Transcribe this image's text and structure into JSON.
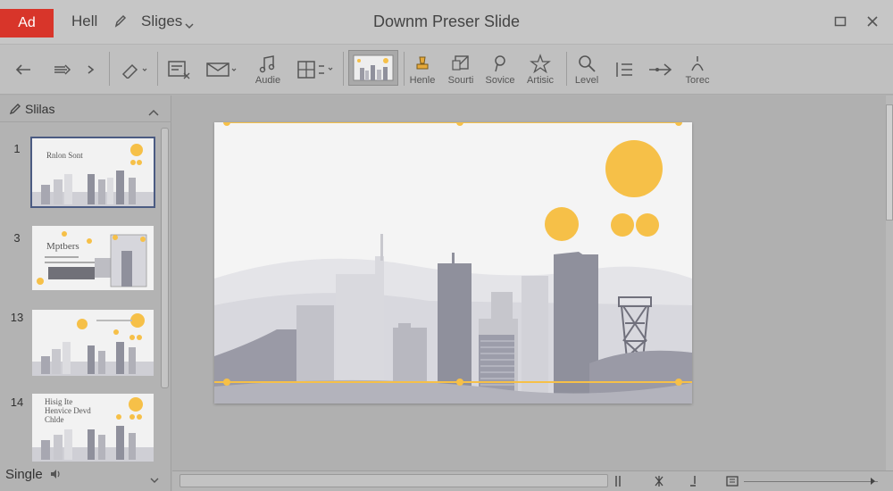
{
  "titlebar": {
    "app_button": "Ad",
    "menu": [
      "Hell",
      "Sliges"
    ],
    "doc_title": "Downm Preser Slide"
  },
  "toolbar": {
    "labels": {
      "audio": "Audie",
      "handle": "Henle",
      "search": "Sourti",
      "source": "Sovice",
      "artistic": "Artisic",
      "level": "Level",
      "tone": "Torec"
    }
  },
  "sidebar": {
    "title": "Slilas",
    "slides": [
      {
        "number": "1",
        "title": "Rnlon Sont"
      },
      {
        "number": "3",
        "title": "Mptbers"
      },
      {
        "number": "13",
        "title": ""
      },
      {
        "number": "14",
        "title": "Hisig Ite\nHenvice Devd\nChlde"
      }
    ],
    "status_label": "Single"
  },
  "colors": {
    "accent_red": "#d8352a",
    "sun_yellow": "#f6c048",
    "building_gray": "#8f909c",
    "building_light": "#c9c9cf",
    "slide_bg": "#f4f4f4"
  }
}
